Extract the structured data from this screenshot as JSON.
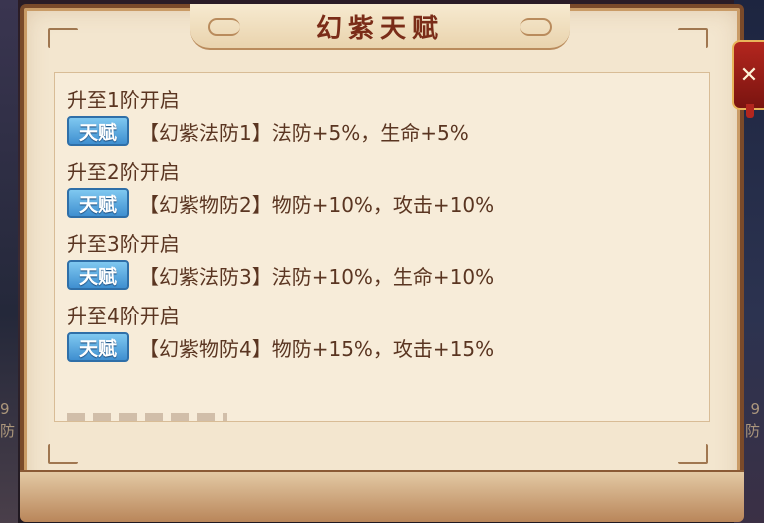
{
  "window": {
    "title": "幻紫天赋"
  },
  "edges": {
    "left_text": "9\n防",
    "right_text": "9\n防"
  },
  "entries": [
    {
      "heading": "升至1阶开启",
      "tag": "天赋",
      "text": "【幻紫法防1】法防+5%，生命+5%"
    },
    {
      "heading": "升至2阶开启",
      "tag": "天赋",
      "text": "【幻紫物防2】物防+10%，攻击+10%"
    },
    {
      "heading": "升至3阶开启",
      "tag": "天赋",
      "text": "【幻紫法防3】法防+10%，生命+10%"
    },
    {
      "heading": "升至4阶开启",
      "tag": "天赋",
      "text": "【幻紫物防4】物防+15%，攻击+15%"
    }
  ],
  "colors": {
    "title": "#7a2c18",
    "text": "#5a3521",
    "tag": "#3f8fd0",
    "panel": "#f3e6cf"
  },
  "icons": {
    "close": "close-icon"
  }
}
